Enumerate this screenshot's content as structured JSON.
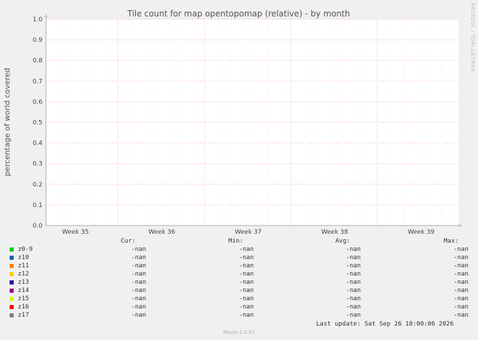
{
  "chart_data": {
    "type": "line",
    "title": "Tile count for map opentopomap (relative) - by month",
    "ylabel": "percentage of world covered",
    "xlabel": "",
    "ylim": [
      0.0,
      1.0
    ],
    "y_ticks": [
      "0.0",
      "0.1",
      "0.2",
      "0.3",
      "0.4",
      "0.5",
      "0.6",
      "0.7",
      "0.8",
      "0.9",
      "1.0"
    ],
    "x_ticks": [
      "Week 35",
      "Week 36",
      "Week 37",
      "Week 38",
      "Week 39"
    ],
    "grid": true,
    "series": [
      {
        "name": "z0-9",
        "color": "#00cc00",
        "values": []
      },
      {
        "name": "z10",
        "color": "#0066b3",
        "values": []
      },
      {
        "name": "z11",
        "color": "#ff8000",
        "values": []
      },
      {
        "name": "z12",
        "color": "#ffcc00",
        "values": []
      },
      {
        "name": "z13",
        "color": "#330099",
        "values": []
      },
      {
        "name": "z14",
        "color": "#990099",
        "values": []
      },
      {
        "name": "z15",
        "color": "#ccff00",
        "values": []
      },
      {
        "name": "z16",
        "color": "#ff0000",
        "values": []
      },
      {
        "name": "z17",
        "color": "#808080",
        "values": []
      }
    ]
  },
  "legend": {
    "headers": {
      "cur": "Cur:",
      "min": "Min:",
      "avg": "Avg:",
      "max": "Max:"
    },
    "rows": [
      {
        "name": "z0-9",
        "cur": "-nan",
        "min": "-nan",
        "avg": "-nan",
        "max": "-nan"
      },
      {
        "name": "z10",
        "cur": "-nan",
        "min": "-nan",
        "avg": "-nan",
        "max": "-nan"
      },
      {
        "name": "z11",
        "cur": "-nan",
        "min": "-nan",
        "avg": "-nan",
        "max": "-nan"
      },
      {
        "name": "z12",
        "cur": "-nan",
        "min": "-nan",
        "avg": "-nan",
        "max": "-nan"
      },
      {
        "name": "z13",
        "cur": "-nan",
        "min": "-nan",
        "avg": "-nan",
        "max": "-nan"
      },
      {
        "name": "z14",
        "cur": "-nan",
        "min": "-nan",
        "avg": "-nan",
        "max": "-nan"
      },
      {
        "name": "z15",
        "cur": "-nan",
        "min": "-nan",
        "avg": "-nan",
        "max": "-nan"
      },
      {
        "name": "z16",
        "cur": "-nan",
        "min": "-nan",
        "avg": "-nan",
        "max": "-nan"
      },
      {
        "name": "z17",
        "cur": "-nan",
        "min": "-nan",
        "avg": "-nan",
        "max": "-nan"
      }
    ]
  },
  "last_update": "Last update: Sat Sep 26 10:00:06 2026",
  "munin_version": "Munin 2.0.57",
  "rrdtool": "RRDTOOL / TOBI OETIKER"
}
